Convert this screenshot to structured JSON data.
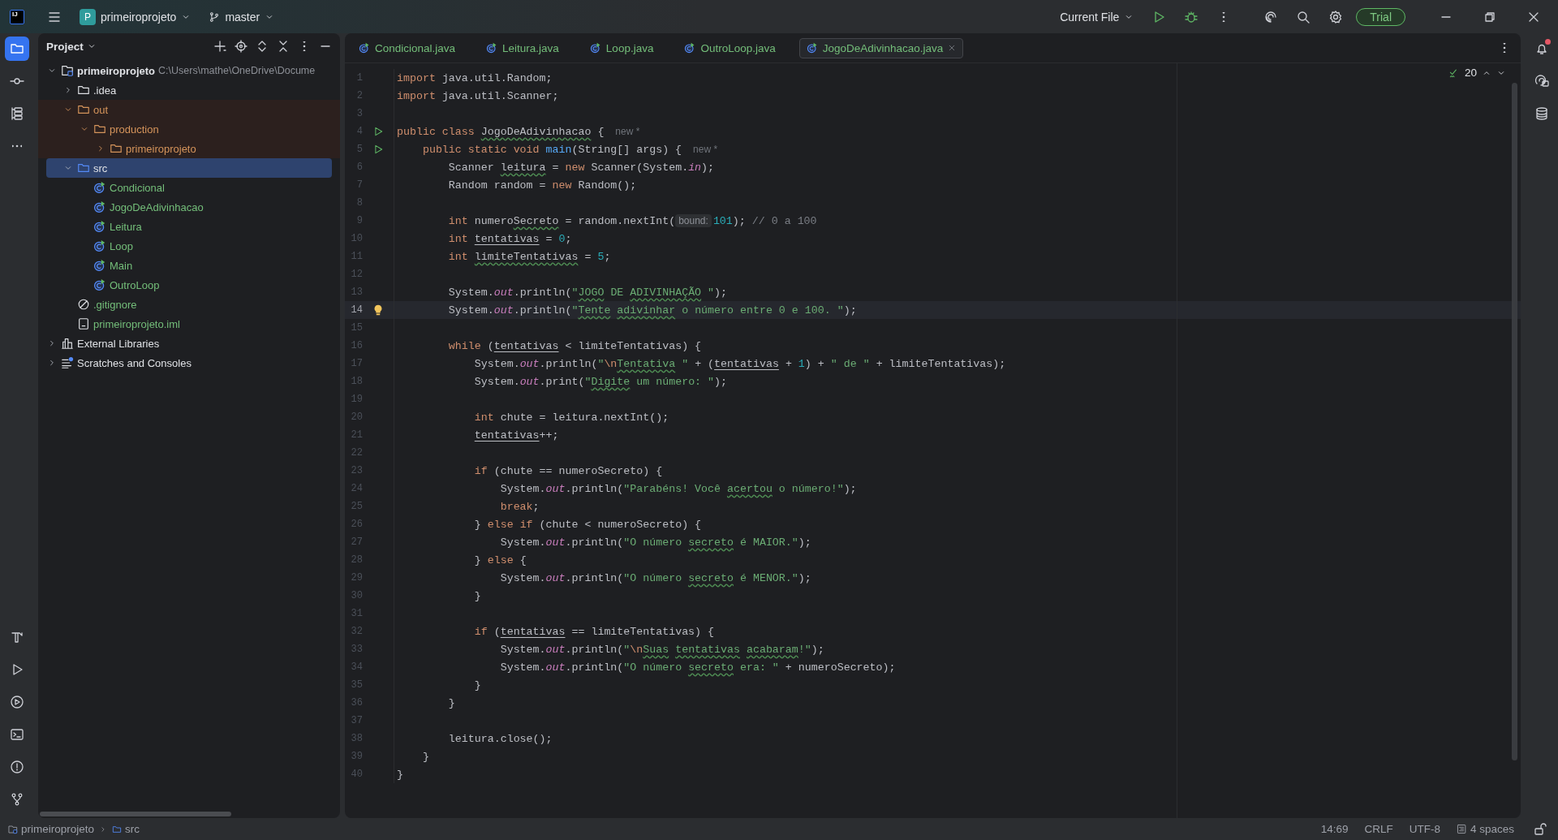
{
  "title_bar": {
    "logo": "IJ",
    "project": {
      "badge": "P",
      "name": "primeiroprojeto"
    },
    "branch": "master",
    "run_config": "Current File",
    "trial": "Trial"
  },
  "left_toolbar": [
    {
      "selected": true
    },
    {
      "selected": false
    },
    {
      "selected": false
    },
    {
      "selected": false
    }
  ],
  "left_toolbar_bottom": [
    {
      "selected": false
    },
    {
      "selected": false
    },
    {
      "selected": false
    },
    {
      "selected": false
    },
    {
      "selected": false
    },
    {
      "selected": false
    }
  ],
  "right_toolbar": [
    {
      "badge": true
    },
    {
      "badge": false
    },
    {
      "badge": false
    }
  ],
  "project_panel": {
    "title": "Project",
    "tree": [
      {
        "name": "primeiroprojeto",
        "path": "C:\\Users\\mathe\\OneDrive\\Docume",
        "kind": "module",
        "expanded": true,
        "excluded": false,
        "selected": false,
        "children": [
          {
            "name": ".idea",
            "kind": "folder",
            "expanded": false,
            "excluded": false,
            "selected": false
          },
          {
            "name": "out",
            "kind": "folder",
            "color": "#d5945b",
            "expanded": true,
            "excluded": true,
            "selected": false,
            "children": [
              {
                "name": "production",
                "kind": "folder",
                "color": "#d5945b",
                "expanded": true,
                "excluded": true,
                "selected": false,
                "children": [
                  {
                    "name": "primeiroprojeto",
                    "kind": "folder",
                    "color": "#d5945b",
                    "expanded": false,
                    "excluded": true,
                    "selected": false
                  }
                ]
              }
            ]
          },
          {
            "name": "src",
            "kind": "source",
            "expanded": true,
            "excluded": false,
            "selected": true,
            "children": [
              {
                "name": "Condicional",
                "kind": "class",
                "color": "#73bd79",
                "excluded": false,
                "selected": false
              },
              {
                "name": "JogoDeAdivinhacao",
                "kind": "class",
                "color": "#73bd79",
                "excluded": false,
                "selected": false
              },
              {
                "name": "Leitura",
                "kind": "class",
                "color": "#73bd79",
                "excluded": false,
                "selected": false
              },
              {
                "name": "Loop",
                "kind": "class",
                "color": "#73bd79",
                "excluded": false,
                "selected": false
              },
              {
                "name": "Main",
                "kind": "class",
                "color": "#73bd79",
                "excluded": false,
                "selected": false
              },
              {
                "name": "OutroLoop",
                "kind": "class",
                "color": "#73bd79",
                "excluded": false,
                "selected": false
              }
            ]
          },
          {
            "name": ".gitignore",
            "kind": "ignore",
            "color": "#73bd79",
            "excluded": false,
            "selected": false
          },
          {
            "name": "primeiroprojeto.iml",
            "kind": "file",
            "color": "#73bd79",
            "excluded": false,
            "selected": false
          }
        ]
      },
      {
        "name": "External Libraries",
        "kind": "library",
        "expanded": false,
        "excluded": false,
        "selected": false
      },
      {
        "name": "Scratches and Consoles",
        "kind": "scratch",
        "expanded": false,
        "excluded": false,
        "selected": false
      }
    ]
  },
  "tabs": [
    {
      "label": "Condicional.java",
      "selected": false
    },
    {
      "label": "Leitura.java",
      "selected": false
    },
    {
      "label": "Loop.java",
      "selected": false
    },
    {
      "label": "OutroLoop.java",
      "selected": false
    },
    {
      "label": "JogoDeAdivinhacao.java",
      "selected": true
    }
  ],
  "editor": {
    "warnings": "20",
    "lines": [
      {
        "n": "1",
        "current": false,
        "tokens": [
          {
            "kind": "keyword",
            "text": "import"
          },
          {
            "kind": "text",
            "text": " java.util.Random;"
          }
        ]
      },
      {
        "n": "2",
        "current": false,
        "tokens": [
          {
            "kind": "keyword",
            "text": "import"
          },
          {
            "kind": "text",
            "text": " java.util.Scanner;"
          }
        ]
      },
      {
        "n": "3",
        "current": false
      },
      {
        "n": "4",
        "current": false,
        "run_marker": true,
        "hint": "new *",
        "tokens": [
          {
            "kind": "keyword",
            "text": "public class "
          },
          {
            "kind": "typo",
            "text": "JogoDeAdivinhacao"
          },
          {
            "kind": "text",
            "text": " {"
          }
        ]
      },
      {
        "n": "5",
        "current": false,
        "run_marker": true,
        "hint": "new *",
        "tokens": [
          {
            "kind": "keyword",
            "text": "    public static void "
          },
          {
            "kind": "method",
            "text": "main"
          },
          {
            "kind": "text",
            "text": "(String[] args) {"
          }
        ]
      },
      {
        "n": "6",
        "current": false,
        "tokens": [
          {
            "kind": "text",
            "text": "        Scanner "
          },
          {
            "kind": "typo",
            "text": "leitura"
          },
          {
            "kind": "text",
            "text": " = "
          },
          {
            "kind": "keyword",
            "text": "new"
          },
          {
            "kind": "text",
            "text": " Scanner(System."
          },
          {
            "kind": "field",
            "text": "in"
          },
          {
            "kind": "text",
            "text": ");"
          }
        ]
      },
      {
        "n": "7",
        "current": false,
        "tokens": [
          {
            "kind": "text",
            "text": "        Random random = "
          },
          {
            "kind": "keyword",
            "text": "new"
          },
          {
            "kind": "text",
            "text": " Random();"
          }
        ]
      },
      {
        "n": "8",
        "current": false
      },
      {
        "n": "9",
        "current": false,
        "tokens": [
          {
            "kind": "keyword",
            "text": "        int"
          },
          {
            "kind": "text",
            "text": " numero"
          },
          {
            "kind": "typo",
            "text": "Secreto"
          },
          {
            "kind": "text",
            "text": " = random.nextInt("
          },
          {
            "kind": "param_hint",
            "text": "bound:"
          },
          {
            "kind": "number",
            "text": "101"
          },
          {
            "kind": "text",
            "text": ");"
          },
          {
            "kind": "comment",
            "text": " // 0 a 100"
          }
        ]
      },
      {
        "n": "10",
        "current": false,
        "tokens": [
          {
            "kind": "keyword",
            "text": "        int"
          },
          {
            "kind": "var",
            "text": " tentativas"
          },
          {
            "kind": "text",
            "text": " = "
          },
          {
            "kind": "number",
            "text": "0"
          },
          {
            "kind": "text",
            "text": ";"
          }
        ]
      },
      {
        "n": "11",
        "current": false,
        "tokens": [
          {
            "kind": "keyword",
            "text": "        int"
          },
          {
            "kind": "typo",
            "text": " limiteTentativas"
          },
          {
            "kind": "text",
            "text": " = "
          },
          {
            "kind": "number",
            "text": "5"
          },
          {
            "kind": "text",
            "text": ";"
          }
        ]
      },
      {
        "n": "12",
        "current": false
      },
      {
        "n": "13",
        "current": false,
        "tokens": [
          {
            "kind": "text",
            "text": "        System."
          },
          {
            "kind": "field",
            "text": "out"
          },
          {
            "kind": "text",
            "text": ".println("
          },
          {
            "kind": "string",
            "text": "\""
          },
          {
            "kind": "string_typo",
            "text": "JOGO"
          },
          {
            "kind": "string",
            "text": " DE"
          },
          {
            "kind": "string_typo",
            "text": " ADIVINHAÇÃO"
          },
          {
            "kind": "string",
            "text": " \""
          },
          {
            "kind": "text",
            "text": ");"
          }
        ]
      },
      {
        "n": "14",
        "current": true,
        "bulb": true,
        "tokens": [
          {
            "kind": "text",
            "text": "        System."
          },
          {
            "kind": "field",
            "text": "out"
          },
          {
            "kind": "text",
            "text": ".println("
          },
          {
            "kind": "string",
            "text": "\""
          },
          {
            "kind": "string_typo",
            "text": "Tente"
          },
          {
            "kind": "string_typo",
            "text": " adivinhar"
          },
          {
            "kind": "string",
            "text": " o número entre 0 e 100. \""
          },
          {
            "kind": "text",
            "text": ");"
          }
        ]
      },
      {
        "n": "15",
        "current": false
      },
      {
        "n": "16",
        "current": false,
        "tokens": [
          {
            "kind": "keyword",
            "text": "        while"
          },
          {
            "kind": "text",
            "text": " ("
          },
          {
            "kind": "var",
            "text": "tentativas"
          },
          {
            "kind": "text",
            "text": " < limiteTentativas) {"
          }
        ]
      },
      {
        "n": "17",
        "current": false,
        "tokens": [
          {
            "kind": "text",
            "text": "            System."
          },
          {
            "kind": "field",
            "text": "out"
          },
          {
            "kind": "text",
            "text": ".println("
          },
          {
            "kind": "string",
            "text": "\""
          },
          {
            "kind": "escape",
            "text": "\\n"
          },
          {
            "kind": "string_typo",
            "text": "Tentativa"
          },
          {
            "kind": "string",
            "text": " \""
          },
          {
            "kind": "text",
            "text": " + ("
          },
          {
            "kind": "var",
            "text": "tentativas"
          },
          {
            "kind": "text",
            "text": " + "
          },
          {
            "kind": "number",
            "text": "1"
          },
          {
            "kind": "text",
            "text": ") + "
          },
          {
            "kind": "string",
            "text": "\" de \""
          },
          {
            "kind": "text",
            "text": " + limiteTentativas);"
          }
        ]
      },
      {
        "n": "18",
        "current": false,
        "tokens": [
          {
            "kind": "text",
            "text": "            System."
          },
          {
            "kind": "field",
            "text": "out"
          },
          {
            "kind": "text",
            "text": ".print("
          },
          {
            "kind": "string",
            "text": "\""
          },
          {
            "kind": "string_typo",
            "text": "Digite"
          },
          {
            "kind": "string",
            "text": " um número: \""
          },
          {
            "kind": "text",
            "text": ");"
          }
        ]
      },
      {
        "n": "19",
        "current": false
      },
      {
        "n": "20",
        "current": false,
        "tokens": [
          {
            "kind": "keyword",
            "text": "            int"
          },
          {
            "kind": "text",
            "text": " chute = leitura.nextInt();"
          }
        ]
      },
      {
        "n": "21",
        "current": false,
        "tokens": [
          {
            "kind": "var",
            "text": "            tentativas"
          },
          {
            "kind": "text",
            "text": "++;"
          }
        ]
      },
      {
        "n": "22",
        "current": false
      },
      {
        "n": "23",
        "current": false,
        "tokens": [
          {
            "kind": "keyword",
            "text": "            if"
          },
          {
            "kind": "text",
            "text": " (chute == numeroSecreto) {"
          }
        ]
      },
      {
        "n": "24",
        "current": false,
        "tokens": [
          {
            "kind": "text",
            "text": "                System."
          },
          {
            "kind": "field",
            "text": "out"
          },
          {
            "kind": "text",
            "text": ".println("
          },
          {
            "kind": "string",
            "text": "\"Parabéns! Você"
          },
          {
            "kind": "string_typo",
            "text": " acertou"
          },
          {
            "kind": "string",
            "text": " o número!\""
          },
          {
            "kind": "text",
            "text": ");"
          }
        ]
      },
      {
        "n": "25",
        "current": false,
        "tokens": [
          {
            "kind": "keyword",
            "text": "                break"
          },
          {
            "kind": "text",
            "text": ";"
          }
        ]
      },
      {
        "n": "26",
        "current": false,
        "tokens": [
          {
            "kind": "text",
            "text": "            }"
          },
          {
            "kind": "keyword",
            "text": " else if"
          },
          {
            "kind": "text",
            "text": " (chute < numeroSecreto) {"
          }
        ]
      },
      {
        "n": "27",
        "current": false,
        "tokens": [
          {
            "kind": "text",
            "text": "                System."
          },
          {
            "kind": "field",
            "text": "out"
          },
          {
            "kind": "text",
            "text": ".println("
          },
          {
            "kind": "string",
            "text": "\"O número"
          },
          {
            "kind": "string_typo",
            "text": " secreto"
          },
          {
            "kind": "string",
            "text": " é MAIOR.\""
          },
          {
            "kind": "text",
            "text": ");"
          }
        ]
      },
      {
        "n": "28",
        "current": false,
        "tokens": [
          {
            "kind": "text",
            "text": "            }"
          },
          {
            "kind": "keyword",
            "text": " else"
          },
          {
            "kind": "text",
            "text": " {"
          }
        ]
      },
      {
        "n": "29",
        "current": false,
        "tokens": [
          {
            "kind": "text",
            "text": "                System."
          },
          {
            "kind": "field",
            "text": "out"
          },
          {
            "kind": "text",
            "text": ".println("
          },
          {
            "kind": "string",
            "text": "\"O número"
          },
          {
            "kind": "string_typo",
            "text": " secreto"
          },
          {
            "kind": "string",
            "text": " é MENOR.\""
          },
          {
            "kind": "text",
            "text": ");"
          }
        ]
      },
      {
        "n": "30",
        "current": false,
        "tokens": [
          {
            "kind": "text",
            "text": "            }"
          }
        ]
      },
      {
        "n": "31",
        "current": false
      },
      {
        "n": "32",
        "current": false,
        "tokens": [
          {
            "kind": "keyword",
            "text": "            if"
          },
          {
            "kind": "text",
            "text": " ("
          },
          {
            "kind": "var",
            "text": "tentativas"
          },
          {
            "kind": "text",
            "text": " == limiteTentativas) {"
          }
        ]
      },
      {
        "n": "33",
        "current": false,
        "tokens": [
          {
            "kind": "text",
            "text": "                System."
          },
          {
            "kind": "field",
            "text": "out"
          },
          {
            "kind": "text",
            "text": ".println("
          },
          {
            "kind": "string",
            "text": "\""
          },
          {
            "kind": "escape",
            "text": "\\n"
          },
          {
            "kind": "string_typo",
            "text": "Suas"
          },
          {
            "kind": "string_typo",
            "text": " tentativas"
          },
          {
            "kind": "string_typo",
            "text": " acabaram"
          },
          {
            "kind": "string",
            "text": "!\""
          },
          {
            "kind": "text",
            "text": ");"
          }
        ]
      },
      {
        "n": "34",
        "current": false,
        "tokens": [
          {
            "kind": "text",
            "text": "                System."
          },
          {
            "kind": "field",
            "text": "out"
          },
          {
            "kind": "text",
            "text": ".println("
          },
          {
            "kind": "string",
            "text": "\"O número"
          },
          {
            "kind": "string_typo",
            "text": " secreto"
          },
          {
            "kind": "string",
            "text": " era: \""
          },
          {
            "kind": "text",
            "text": " + numeroSecreto);"
          }
        ]
      },
      {
        "n": "35",
        "current": false,
        "tokens": [
          {
            "kind": "text",
            "text": "            }"
          }
        ]
      },
      {
        "n": "36",
        "current": false,
        "tokens": [
          {
            "kind": "text",
            "text": "        }"
          }
        ]
      },
      {
        "n": "37",
        "current": false
      },
      {
        "n": "38",
        "current": false,
        "tokens": [
          {
            "kind": "text",
            "text": "        leitura.close();"
          }
        ]
      },
      {
        "n": "39",
        "current": false,
        "tokens": [
          {
            "kind": "text",
            "text": "    }"
          }
        ]
      },
      {
        "n": "40",
        "current": false,
        "tokens": [
          {
            "kind": "text",
            "text": "}"
          }
        ]
      }
    ]
  },
  "status_bar": {
    "breadcrumbs": [
      "primeiroprojeto",
      "src"
    ],
    "position": "14:69",
    "line_separator": "CRLF",
    "encoding": "UTF-8",
    "indent": "4 spaces"
  }
}
